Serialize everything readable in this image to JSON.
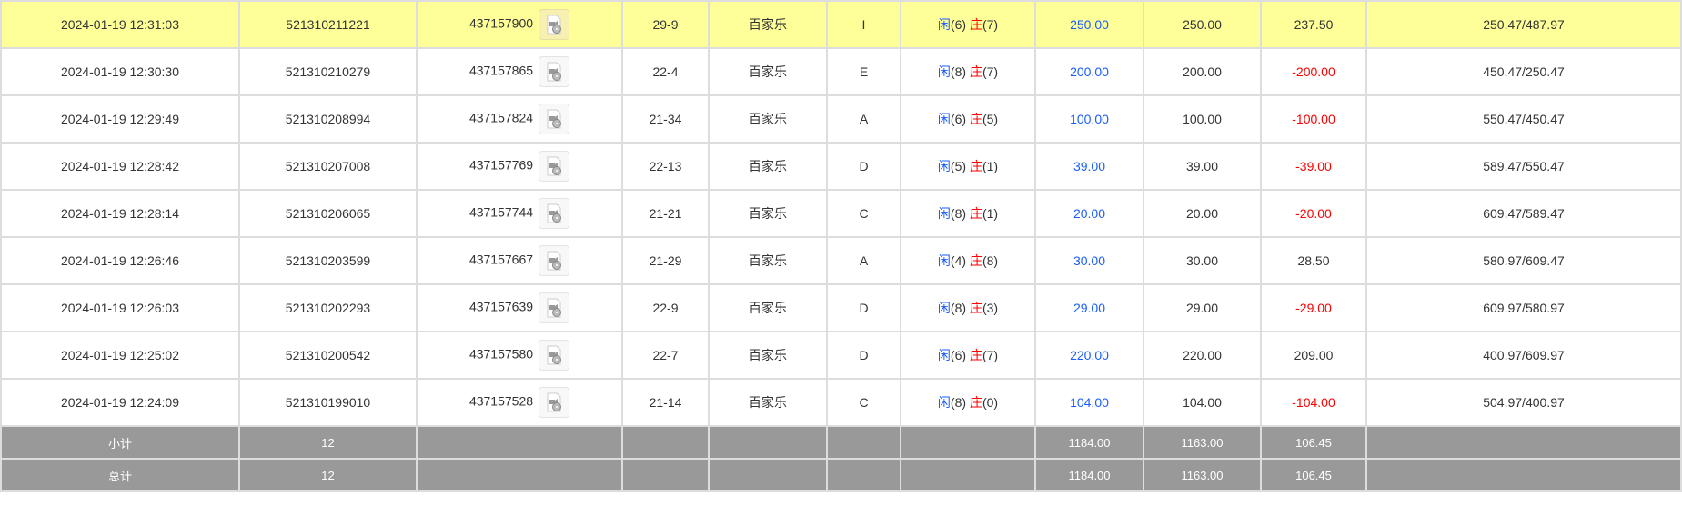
{
  "rows": [
    {
      "time": "2024-01-19 12:31:03",
      "bet_id": "521310211221",
      "round_id": "437157900",
      "table": "29-9",
      "game": "百家乐",
      "seat": "I",
      "player_label": "闲",
      "player_pts": "(6)",
      "banker_label": "庄",
      "banker_pts": "(7)",
      "bet": "250.00",
      "valid": "250.00",
      "win": "237.50",
      "win_neg": false,
      "balance": "250.47/487.97",
      "highlight": true
    },
    {
      "time": "2024-01-19 12:30:30",
      "bet_id": "521310210279",
      "round_id": "437157865",
      "table": "22-4",
      "game": "百家乐",
      "seat": "E",
      "player_label": "闲",
      "player_pts": "(8)",
      "banker_label": "庄",
      "banker_pts": "(7)",
      "bet": "200.00",
      "valid": "200.00",
      "win": "-200.00",
      "win_neg": true,
      "balance": "450.47/250.47"
    },
    {
      "time": "2024-01-19 12:29:49",
      "bet_id": "521310208994",
      "round_id": "437157824",
      "table": "21-34",
      "game": "百家乐",
      "seat": "A",
      "player_label": "闲",
      "player_pts": "(6)",
      "banker_label": "庄",
      "banker_pts": "(5)",
      "bet": "100.00",
      "valid": "100.00",
      "win": "-100.00",
      "win_neg": true,
      "balance": "550.47/450.47"
    },
    {
      "time": "2024-01-19 12:28:42",
      "bet_id": "521310207008",
      "round_id": "437157769",
      "table": "22-13",
      "game": "百家乐",
      "seat": "D",
      "player_label": "闲",
      "player_pts": "(5)",
      "banker_label": "庄",
      "banker_pts": "(1)",
      "bet": "39.00",
      "valid": "39.00",
      "win": "-39.00",
      "win_neg": true,
      "balance": "589.47/550.47"
    },
    {
      "time": "2024-01-19 12:28:14",
      "bet_id": "521310206065",
      "round_id": "437157744",
      "table": "21-21",
      "game": "百家乐",
      "seat": "C",
      "player_label": "闲",
      "player_pts": "(8)",
      "banker_label": "庄",
      "banker_pts": "(1)",
      "bet": "20.00",
      "valid": "20.00",
      "win": "-20.00",
      "win_neg": true,
      "balance": "609.47/589.47"
    },
    {
      "time": "2024-01-19 12:26:46",
      "bet_id": "521310203599",
      "round_id": "437157667",
      "table": "21-29",
      "game": "百家乐",
      "seat": "A",
      "player_label": "闲",
      "player_pts": "(4)",
      "banker_label": "庄",
      "banker_pts": "(8)",
      "bet": "30.00",
      "valid": "30.00",
      "win": "28.50",
      "win_neg": false,
      "balance": "580.97/609.47"
    },
    {
      "time": "2024-01-19 12:26:03",
      "bet_id": "521310202293",
      "round_id": "437157639",
      "table": "22-9",
      "game": "百家乐",
      "seat": "D",
      "player_label": "闲",
      "player_pts": "(8)",
      "banker_label": "庄",
      "banker_pts": "(3)",
      "bet": "29.00",
      "valid": "29.00",
      "win": "-29.00",
      "win_neg": true,
      "balance": "609.97/580.97"
    },
    {
      "time": "2024-01-19 12:25:02",
      "bet_id": "521310200542",
      "round_id": "437157580",
      "table": "22-7",
      "game": "百家乐",
      "seat": "D",
      "player_label": "闲",
      "player_pts": "(6)",
      "banker_label": "庄",
      "banker_pts": "(7)",
      "bet": "220.00",
      "valid": "220.00",
      "win": "209.00",
      "win_neg": false,
      "balance": "400.97/609.97"
    },
    {
      "time": "2024-01-19 12:24:09",
      "bet_id": "521310199010",
      "round_id": "437157528",
      "table": "21-14",
      "game": "百家乐",
      "seat": "C",
      "player_label": "闲",
      "player_pts": "(8)",
      "banker_label": "庄",
      "banker_pts": "(0)",
      "bet": "104.00",
      "valid": "104.00",
      "win": "-104.00",
      "win_neg": true,
      "balance": "504.97/400.97"
    }
  ],
  "subtotal": {
    "label": "小计",
    "count": "12",
    "bet": "1184.00",
    "valid": "1163.00",
    "win": "106.45"
  },
  "total": {
    "label": "总计",
    "count": "12",
    "bet": "1184.00",
    "valid": "1163.00",
    "win": "106.45"
  },
  "icons": {
    "replay": "video-replay-icon"
  },
  "colors": {
    "highlight": "#ffff99",
    "blue": "#1a5cff",
    "red": "#ff0000",
    "summary_bg": "#999999"
  }
}
